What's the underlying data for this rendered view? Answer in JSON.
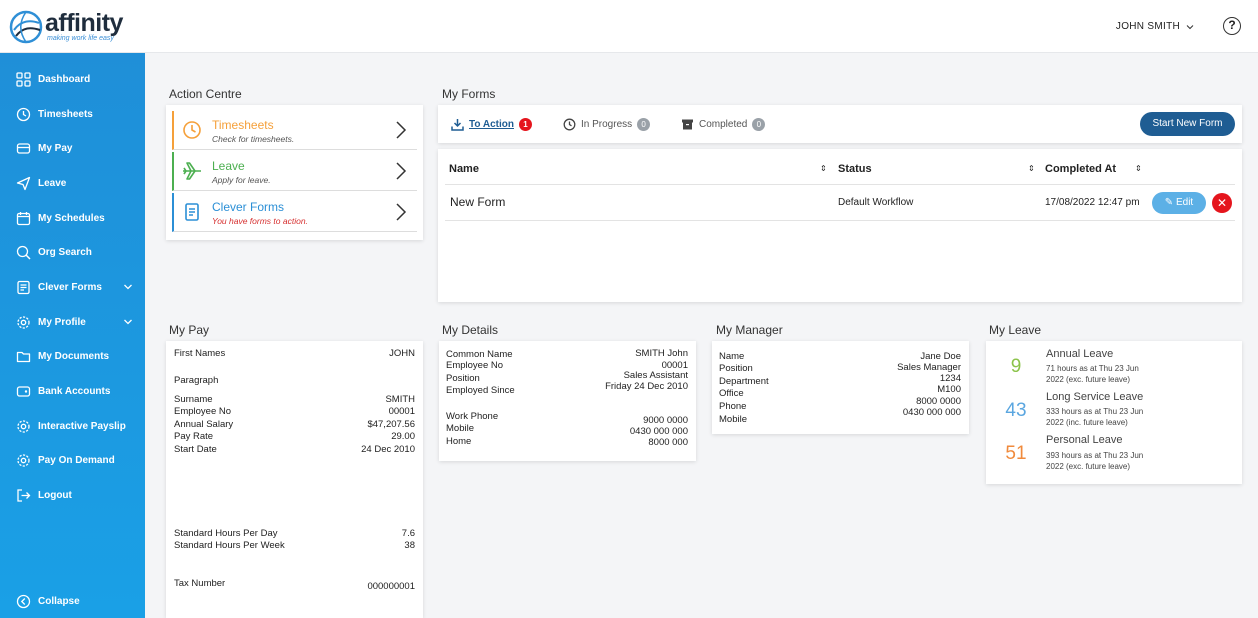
{
  "app": {
    "logo_word": "affinity",
    "logo_tagline": "making work life easy",
    "user_name": "JOHN SMITH",
    "help_label": "?"
  },
  "sidebar": {
    "items": [
      {
        "label": "Dashboard",
        "icon": "dashboard-icon"
      },
      {
        "label": "Timesheets",
        "icon": "clock-icon"
      },
      {
        "label": "My Pay",
        "icon": "wallet-icon"
      },
      {
        "label": "Leave",
        "icon": "paper-plane-icon"
      },
      {
        "label": "My Schedules",
        "icon": "calendar-icon"
      },
      {
        "label": "Org Search",
        "icon": "search-icon"
      },
      {
        "label": "Clever Forms",
        "icon": "forms-icon"
      },
      {
        "label": "My Profile",
        "icon": "gear-icon"
      },
      {
        "label": "My Documents",
        "icon": "folder-icon"
      },
      {
        "label": "Bank Accounts",
        "icon": "bank-icon"
      },
      {
        "label": "Interactive Payslip",
        "icon": "gear-icon"
      },
      {
        "label": "Pay On Demand",
        "icon": "gear-icon"
      },
      {
        "label": "Logout",
        "icon": "logout-icon"
      }
    ],
    "collapse_label": "Collapse"
  },
  "action_centre": {
    "title": "Action Centre",
    "items": [
      {
        "title": "Timesheets",
        "subtitle": "Check for timesheets.",
        "color": "#f5a03a"
      },
      {
        "title": "Leave",
        "subtitle": "Apply for leave.",
        "color": "#4caf50"
      },
      {
        "title": "Clever Forms",
        "subtitle": "You have forms to action.",
        "color": "#2b8fd6"
      }
    ]
  },
  "my_forms": {
    "title": "My Forms",
    "tabs": [
      {
        "label": "To Action",
        "count": "1"
      },
      {
        "label": "In Progress",
        "count": "0"
      },
      {
        "label": "Completed",
        "count": "0"
      }
    ],
    "start_button": "Start New Form",
    "columns": [
      "Name",
      "Status",
      "Completed At"
    ],
    "rows": [
      {
        "name": "New Form",
        "status": "Default Workflow",
        "completed_at": "17/08/2022 12:47 pm"
      }
    ],
    "edit_label": "Edit",
    "delete_label": "✕"
  },
  "my_pay": {
    "title": "My Pay",
    "first_names_label": "First Names",
    "first_names": "JOHN",
    "paragraph_label": "Paragraph",
    "rows": [
      {
        "label": "Surname",
        "value": "SMITH"
      },
      {
        "label": "Employee No",
        "value": "00001"
      },
      {
        "label": "Annual Salary",
        "value": "$47,207.56"
      },
      {
        "label": "Pay Rate",
        "value": "29.00"
      },
      {
        "label": "Start Date",
        "value": "24 Dec 2010"
      }
    ],
    "hours": [
      {
        "label": "Standard Hours Per Day",
        "value": "7.6"
      },
      {
        "label": "Standard Hours Per Week",
        "value": "38"
      }
    ],
    "tax_label": "Tax Number",
    "tax_value": "000000001"
  },
  "my_details": {
    "title": "My Details",
    "rows1": [
      {
        "label": "Common Name",
        "value": "SMITH John"
      },
      {
        "label": "Employee No",
        "value": "00001"
      },
      {
        "label": "Position",
        "value": "Sales Assistant"
      },
      {
        "label": "Employed Since",
        "value": "Friday 24 Dec 2010"
      }
    ],
    "rows2": [
      {
        "label": "Work Phone",
        "value": "9000 0000"
      },
      {
        "label": "Mobile",
        "value": "0430 000 000"
      },
      {
        "label": "Home",
        "value": "8000 000"
      }
    ]
  },
  "my_manager": {
    "title": "My Manager",
    "rows": [
      {
        "label": "Name",
        "value": "Jane Doe"
      },
      {
        "label": "Position",
        "value": "Sales Manager"
      },
      {
        "label": "Department",
        "value": "1234"
      },
      {
        "label": "Office",
        "value": "M100"
      },
      {
        "label": "Phone",
        "value": "8000 0000"
      },
      {
        "label": "Mobile",
        "value": "0430 000 000"
      }
    ]
  },
  "my_leave": {
    "title": "My Leave",
    "items": [
      {
        "num": "9",
        "title": "Annual Leave",
        "line1": "71 hours as at Thu 23 Jun",
        "line2": "2022 (exc. future leave)",
        "color": "#8bc34a"
      },
      {
        "num": "43",
        "title": "Long Service Leave",
        "line1": "333 hours as at Thu 23 Jun",
        "line2": "2022 (inc. future leave)",
        "color": "#5aa6e0"
      },
      {
        "num": "51",
        "title": "Personal Leave",
        "line1": "393 hours as at Thu 23 Jun",
        "line2": "2022 (exc. future leave)",
        "color": "#f08a3c"
      }
    ]
  }
}
